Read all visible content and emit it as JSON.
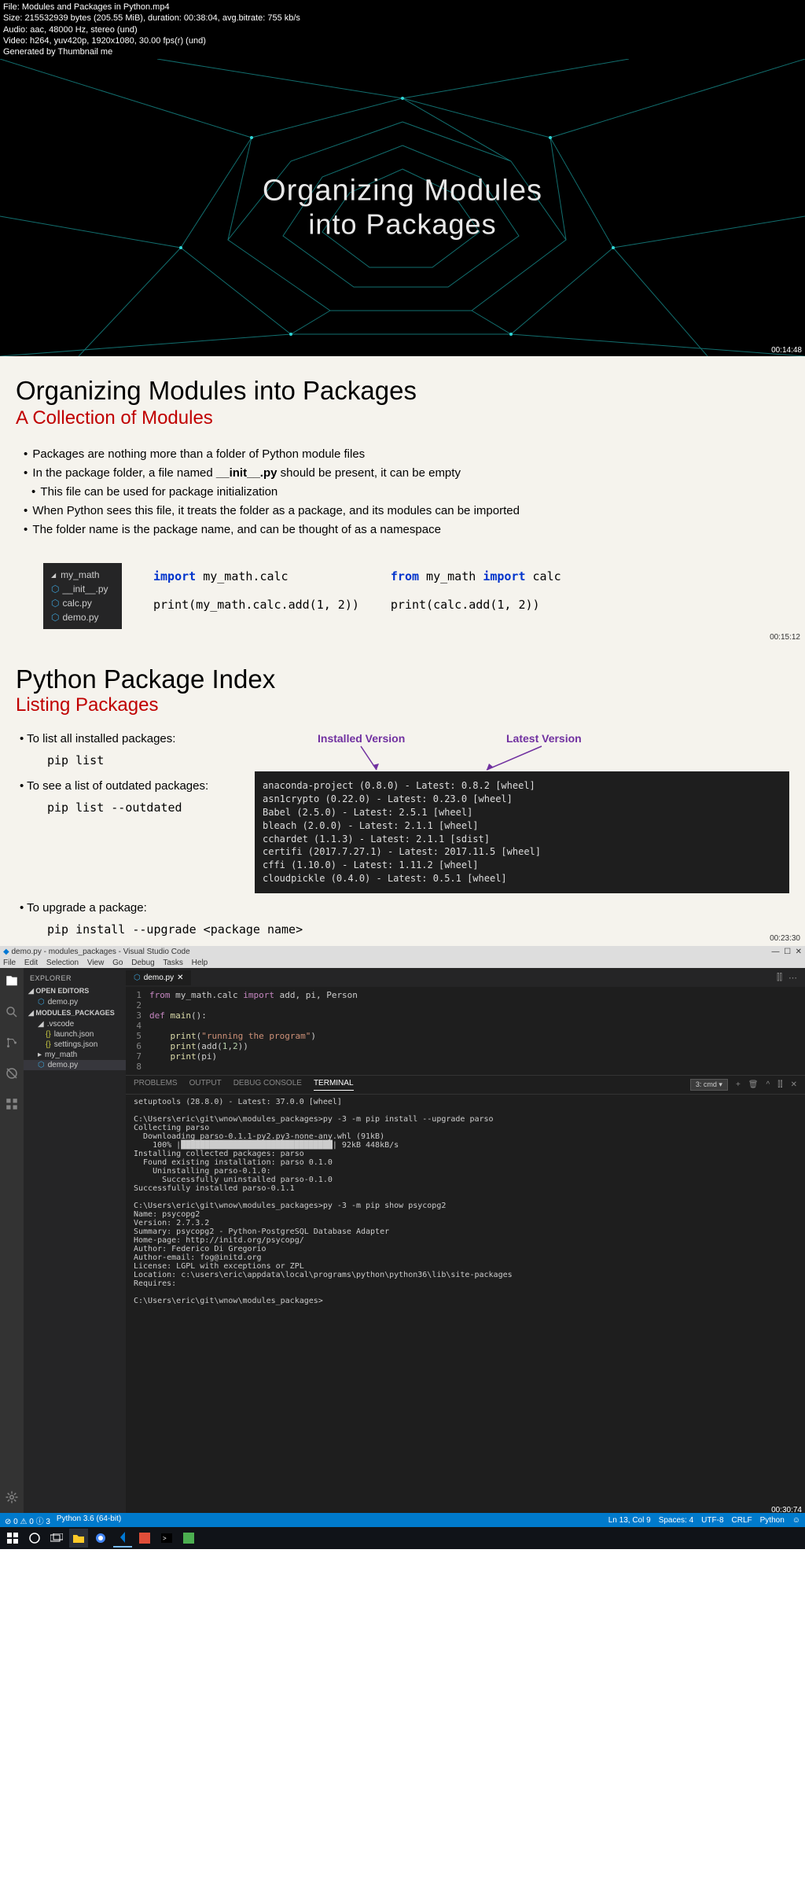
{
  "meta": {
    "file": "File: Modules and Packages in Python.mp4",
    "size": "Size: 215532939 bytes (205.55 MiB), duration: 00:38:04, avg.bitrate: 755 kb/s",
    "audio": "Audio: aac, 48000 Hz, stereo (und)",
    "video": "Video: h264, yuv420p, 1920x1080, 30.00 fps(r) (und)",
    "gen": "Generated by Thumbnail me"
  },
  "thumb": {
    "title1": "Organizing Modules",
    "title2": "into Packages",
    "ts": "00:14:48"
  },
  "slide1": {
    "title": "Organizing Modules into Packages",
    "subtitle": "A Collection of Modules",
    "b1": "Packages are nothing more than a folder of Python module files",
    "b2a": "In the package folder, a file named ",
    "b2b": "__init__.py",
    "b2c": " should be present, it can be empty",
    "b3": "This file can be used for package initialization",
    "b4": "When Python sees this file, it treats the folder as a package, and its modules can be imported",
    "b5": "The folder name is the package name, and can be thought of as a namespace",
    "tree": {
      "folder": "my_math",
      "f1": "__init__.py",
      "f2": "calc.py",
      "f3": "demo.py"
    },
    "code1a": "import",
    "code1b": " my_math.calc",
    "code1c": "print(my_math.calc.add(1, 2))",
    "code2a": "from",
    "code2b": " my_math ",
    "code2c": "import",
    "code2d": " calc",
    "code2e": "print(calc.add(1, 2))",
    "ts": "00:15:12"
  },
  "slide2": {
    "title": "Python Package Index",
    "subtitle": "Listing Packages",
    "t1": "To list all installed packages:",
    "c1": "pip list",
    "t2": "To see a list of outdated packages:",
    "c2": "pip list --outdated",
    "t3": "To upgrade a package:",
    "c3": "pip install --upgrade <package name>",
    "lbl1": "Installed Version",
    "lbl2": "Latest Version",
    "term": "anaconda-project (0.8.0) - Latest: 0.8.2 [wheel]\nasn1crypto (0.22.0) - Latest: 0.23.0 [wheel]\nBabel (2.5.0) - Latest: 2.5.1 [wheel]\nbleach (2.0.0) - Latest: 2.1.1 [wheel]\ncchardet (1.1.3) - Latest: 2.1.1 [sdist]\ncertifi (2017.7.27.1) - Latest: 2017.11.5 [wheel]\ncffi (1.10.0) - Latest: 1.11.2 [wheel]\ncloudpickle (0.4.0) - Latest: 0.5.1 [wheel]",
    "ts": "00:23:30"
  },
  "vscode": {
    "title": "demo.py - modules_packages - Visual Studio Code",
    "menu": [
      "File",
      "Edit",
      "Selection",
      "View",
      "Go",
      "Debug",
      "Tasks",
      "Help"
    ],
    "explorer": "EXPLORER",
    "open_editors": "OPEN EDITORS",
    "demo": "demo.py",
    "project": "MODULES_PACKAGES",
    "vscode_folder": ".vscode",
    "launch": "launch.json",
    "settings": "settings.json",
    "mymath": "my_math",
    "tab": "demo.py",
    "code": {
      "l1": {
        "kw": "from",
        "a": " my_math.calc ",
        "kw2": "import",
        "b": " add, pi, Person"
      },
      "l3": {
        "kw": "def",
        "fn": " main",
        "p": "():"
      },
      "l5": {
        "fn": "print",
        "s": "(\"running the program\")"
      },
      "l6": {
        "fn": "print",
        "p": "(add(",
        "n1": "1",
        "c": ",",
        "n2": "2",
        "e": "))"
      },
      "l7": {
        "fn": "print",
        "p": "(pi)"
      }
    },
    "panel_tabs": [
      "PROBLEMS",
      "OUTPUT",
      "DEBUG CONSOLE",
      "TERMINAL"
    ],
    "term_dropdown": "3: cmd",
    "terminal": "setuptools (28.8.0) - Latest: 37.0.0 [wheel]\n\nC:\\Users\\eric\\git\\wnow\\modules_packages>py -3 -m pip install --upgrade parso\nCollecting parso\n  Downloading parso-0.1.1-py2.py3-none-any.whl (91kB)\n    100% |████████████████████████████████| 92kB 448kB/s\nInstalling collected packages: parso\n  Found existing installation: parso 0.1.0\n    Uninstalling parso-0.1.0:\n      Successfully uninstalled parso-0.1.0\nSuccessfully installed parso-0.1.1\n\nC:\\Users\\eric\\git\\wnow\\modules_packages>py -3 -m pip show psycopg2\nName: psycopg2\nVersion: 2.7.3.2\nSummary: psycopg2 - Python-PostgreSQL Database Adapter\nHome-page: http://initd.org/psycopg/\nAuthor: Federico Di Gregorio\nAuthor-email: fog@initd.org\nLicense: LGPL with exceptions or ZPL\nLocation: c:\\users\\eric\\appdata\\local\\programs\\python\\python36\\lib\\site-packages\nRequires:\n\nC:\\Users\\eric\\git\\wnow\\modules_packages>",
    "status_left": [
      "⊘ 0 ⚠ 0 ⓘ 3",
      "Python 3.6 (64-bit)"
    ],
    "status_right": [
      "Ln 13, Col 9",
      "Spaces: 4",
      "UTF-8",
      "CRLF",
      "Python",
      "☺"
    ],
    "ts": "00:30:74"
  }
}
